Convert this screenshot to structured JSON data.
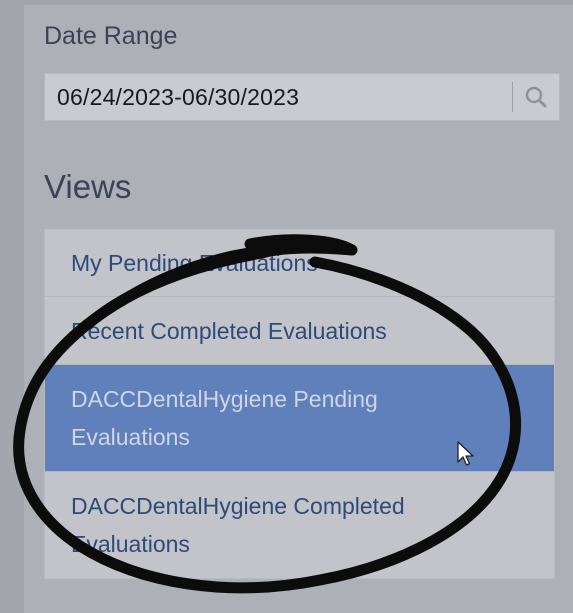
{
  "date_range": {
    "label": "Date Range",
    "value": "06/24/2023-06/30/2023",
    "search_icon": "search-icon"
  },
  "views": {
    "heading": "Views",
    "items": [
      {
        "label": "My Pending Evaluations",
        "selected": false
      },
      {
        "label": "Recent Completed Evaluations",
        "selected": false
      },
      {
        "label": "DACCDentalHygiene Pending Evaluations",
        "selected": true
      },
      {
        "label": "DACCDentalHygiene Completed Evaluations",
        "selected": false
      }
    ]
  },
  "colors": {
    "selected_row": "#5f80ba",
    "link_text": "#2e4a78",
    "ink_annotation": "#0c0c0c"
  }
}
